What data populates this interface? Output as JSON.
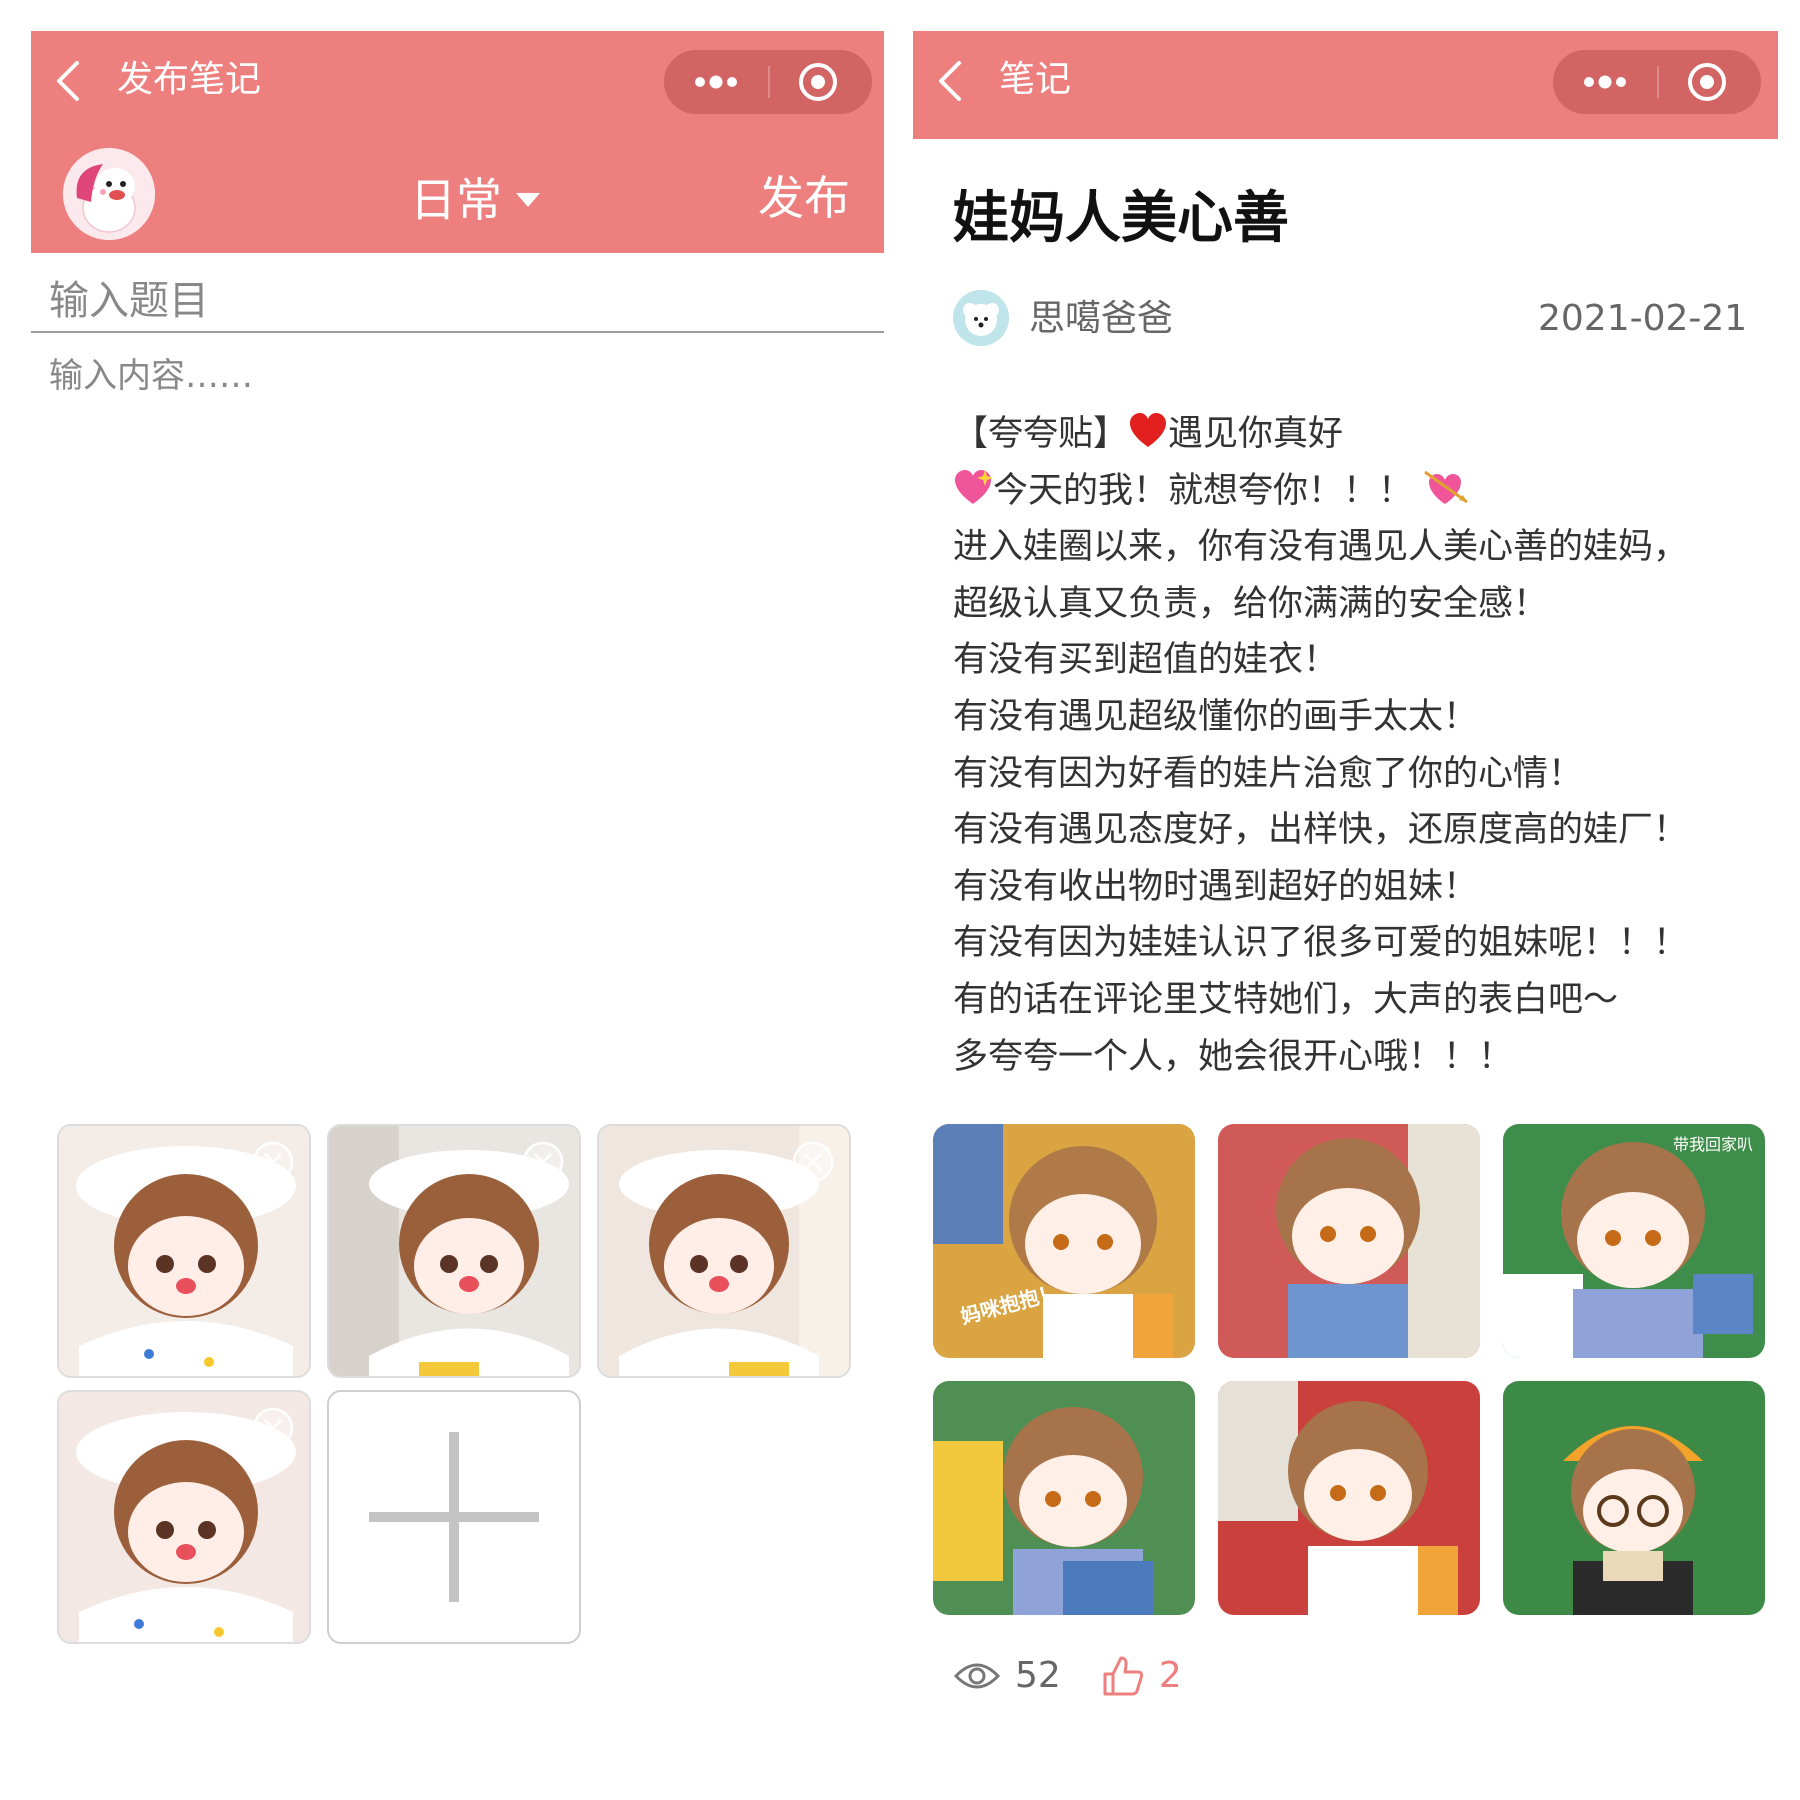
{
  "colors": {
    "accent": "#ee7f7f",
    "capsule": "#d36464",
    "text_muted": "#888888",
    "like": "#ee7f7f"
  },
  "left": {
    "nav_title": "发布笔记",
    "category": "日常",
    "publish_label": "发布",
    "title_placeholder": "输入题目",
    "content_placeholder": "输入内容……",
    "icons": {
      "back": "chevron-left-icon",
      "more": "more-dots-icon",
      "close": "target-circle-icon",
      "dropdown": "caret-down-icon",
      "remove": "close-icon",
      "add": "plus-icon"
    },
    "thumbnails": [
      {
        "name": "doll-photo-1"
      },
      {
        "name": "doll-photo-2"
      },
      {
        "name": "doll-photo-3"
      },
      {
        "name": "doll-photo-4"
      }
    ]
  },
  "right": {
    "nav_title": "笔记",
    "post_title": "娃妈人美心善",
    "author": "思噶爸爸",
    "date": "2021-02-21",
    "body_lines": [
      {
        "pre": "【夸夸贴】",
        "emoji": "red-heart-icon",
        "text": "遇见你真好"
      },
      {
        "pre": "",
        "emoji": "sparkling-heart-icon",
        "text": "今天的我！就想夸你！！！",
        "post_emoji": "heart-arrow-icon"
      },
      {
        "text": "进入娃圈以来，你有没有遇见人美心善的娃妈，"
      },
      {
        "text": "超级认真又负责，给你满满的安全感！"
      },
      {
        "text": "有没有买到超值的娃衣！"
      },
      {
        "text": "有没有遇见超级懂你的画手太太！"
      },
      {
        "text": "有没有因为好看的娃片治愈了你的心情！"
      },
      {
        "text": "有没有遇见态度好，出样快，还原度高的娃厂！"
      },
      {
        "text": "有没有收出物时遇到超好的姐妹！"
      },
      {
        "text": "有没有因为娃娃认识了很多可爱的姐妹呢！！！"
      },
      {
        "text": "有的话在评论里艾特她们，大声的表白吧～"
      },
      {
        "text": "多夸夸一个人，她会很开心哦！！！"
      }
    ],
    "image_captions": [
      "妈咪抱抱！",
      "带我回家叭"
    ],
    "gallery": [
      {
        "name": "gallery-photo-1"
      },
      {
        "name": "gallery-photo-2"
      },
      {
        "name": "gallery-photo-3"
      },
      {
        "name": "gallery-photo-4"
      },
      {
        "name": "gallery-photo-5"
      },
      {
        "name": "gallery-photo-6"
      }
    ],
    "views": "52",
    "likes": "2",
    "icons": {
      "views": "eye-icon",
      "likes": "thumbs-up-icon"
    }
  }
}
